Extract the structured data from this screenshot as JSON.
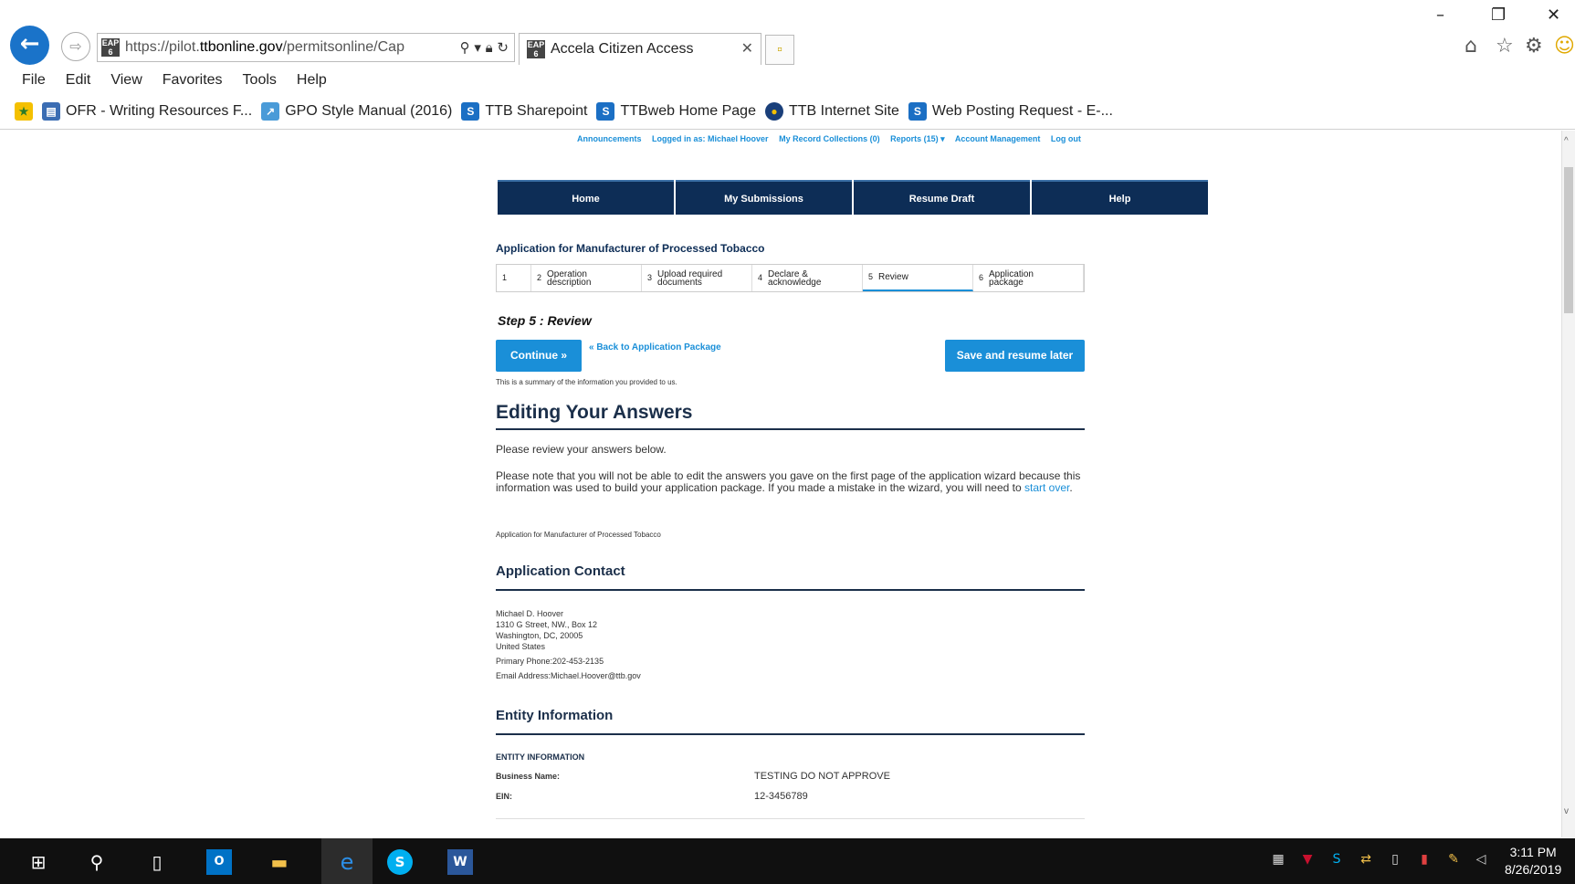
{
  "browser": {
    "url_prefix": "https://pilot.",
    "url_domain": "ttbonline.gov",
    "url_path": "/permitsonline/Cap",
    "favicon_text": "EAP 6",
    "tab_title": "Accela Citizen Access",
    "window_controls": {
      "minimize": "–",
      "restore": "❐",
      "close": "✕"
    },
    "menu": [
      "File",
      "Edit",
      "View",
      "Favorites",
      "Tools",
      "Help"
    ],
    "favorites": [
      {
        "label": "OFR - Writing Resources F...",
        "icon": "document-icon",
        "color": "#3b6db3"
      },
      {
        "label": "GPO Style Manual (2016)",
        "icon": "gpo-icon",
        "color": "#4a9bd8"
      },
      {
        "label": "TTB Sharepoint",
        "icon": "sharepoint-icon",
        "color": "#1b6fc4"
      },
      {
        "label": "TTBweb Home Page",
        "icon": "sharepoint-icon",
        "color": "#1b6fc4"
      },
      {
        "label": "TTB Internet Site",
        "icon": "ttb-seal-icon",
        "color": "#1a3f7a"
      },
      {
        "label": "Web Posting Request - E-...",
        "icon": "sharepoint-icon",
        "color": "#1b6fc4"
      }
    ]
  },
  "page": {
    "top_links": [
      "Announcements",
      "Logged in as: Michael Hoover",
      "My Record Collections (0)",
      "Reports (15) ▾",
      "Account Management",
      "Log out"
    ],
    "nav": [
      "Home",
      "My Submissions",
      "Resume Draft",
      "Help"
    ],
    "app_title": "Application for Manufacturer of Processed Tobacco",
    "steps": [
      {
        "num": "1",
        "label": ""
      },
      {
        "num": "2",
        "label": "Operation description"
      },
      {
        "num": "3",
        "label": "Upload required documents"
      },
      {
        "num": "4",
        "label": "Declare & acknowledge"
      },
      {
        "num": "5",
        "label": "Review"
      },
      {
        "num": "6",
        "label": "Application package"
      }
    ],
    "step_heading": "Step 5 : Review",
    "continue_label": "Continue »",
    "back_link": "« Back to Application Package",
    "save_label": "Save and resume later",
    "summary_note": "This is a summary of the information you provided to us.",
    "editing_title": "Editing Your Answers",
    "review_text": "Please review your answers below.",
    "note_text": "Please note that you will not be able to edit the answers you gave on the first page of the application wizard because this information was used to build your application package. If you made a mistake in the wizard, you will need to ",
    "start_over": "start over",
    "note_end": ".",
    "app_subtitle": "Application for Manufacturer of Processed Tobacco",
    "contact": {
      "title": "Application Contact",
      "name": "Michael D. Hoover",
      "street": "1310 G Street, NW., Box 12",
      "city": "Washington, DC, 20005",
      "country": "United States",
      "phone": "Primary Phone:202-453-2135",
      "email": "Email Address:Michael.Hoover@ttb.gov"
    },
    "entity": {
      "title": "Entity Information",
      "label": "ENTITY INFORMATION",
      "business_label": "Business Name:",
      "business_value": "TESTING DO NOT APPROVE",
      "ein_label": "EIN:",
      "ein_value": "12-3456789"
    }
  },
  "taskbar": {
    "time": "3:11 PM",
    "date": "8/26/2019"
  }
}
